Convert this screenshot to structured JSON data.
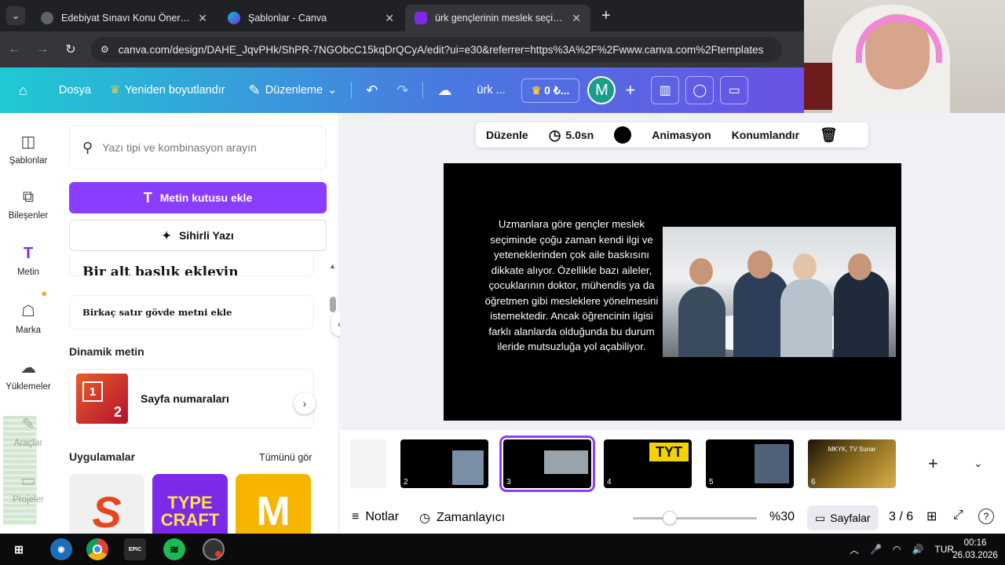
{
  "browser": {
    "tabs": [
      {
        "title": "Edebiyat Sınavı Konu Önerileri",
        "active": false
      },
      {
        "title": "Şablonlar - Canva",
        "active": false
      },
      {
        "title": "ürk gençlerinin meslek seçimi s",
        "active": true
      }
    ],
    "url": "canva.com/design/DAHE_JqvPHk/ShPR-7NGObcC15kqDrQCyA/edit?ui=e30&referrer=https%3A%2F%2Fwww.canva.com%2Ftemplates"
  },
  "header": {
    "file": "Dosya",
    "resize": "Yeniden boyutlandır",
    "edit": "Düzenleme",
    "project": "ürk ...",
    "credit": "0 ₺...",
    "avatar": "M"
  },
  "rail": {
    "templates": "Şablonlar",
    "elements": "Bileşenler",
    "text": "Metin",
    "brand": "Marka",
    "uploads": "Yüklemeler",
    "draw": "Araçlar",
    "projects": "Projeler"
  },
  "panel": {
    "search_placeholder": "Yazı tipi ve kombinasyon arayın",
    "add_textbox": "Metin kutusu ekle",
    "magic_write": "Sihirli Yazı",
    "subtitle": "Bir alt başlık ekleyin",
    "body": "Birkaç satır gövde metni ekle",
    "dynamic_title": "Dinamik metin",
    "page_numbers": "Sayfa numaraları",
    "apps_title": "Uygulamalar",
    "see_all": "Tümünü gör",
    "app2_label": "TYPE CRAFT",
    "app3_label": "M"
  },
  "toolbar": {
    "edit": "Düzenle",
    "duration": "5.0sn",
    "animation": "Animasyon",
    "position": "Konumlandır"
  },
  "slide": {
    "text": "Uzmanlara göre gençler meslek seçiminde çoğu zaman kendi ilgi ve yeteneklerinden çok aile baskısını dikkate alıyor. Özellikle bazı aileler, çocuklarının doktor, mühendis ya da öğretmen gibi mesleklere yönelmesini istemektedir. Ancak öğrencinin ilgisi farklı alanlarda olduğunda bu durum ileride mutsuzluğa yol açabiliyor."
  },
  "filmstrip": {
    "pages": [
      {
        "num": "2"
      },
      {
        "num": "3",
        "selected": true
      },
      {
        "num": "4",
        "title": "TYT"
      },
      {
        "num": "5"
      },
      {
        "num": "6",
        "title": "MKYK, TV Sunar"
      }
    ]
  },
  "bottom": {
    "notes": "Notlar",
    "timer": "Zamanlayıcı",
    "zoom": "%30",
    "zoom_level": 0.3,
    "pages": "Sayfalar",
    "page_count": "3 / 6"
  },
  "taskbar": {
    "lang": "TUR",
    "time": "00:16",
    "date": "26.03.2026",
    "epic": "EPIC"
  },
  "colors": {
    "accent": "#8b3dff",
    "header_gradient_start": "#1fc9d3",
    "header_gradient_end": "#7b3ce8"
  }
}
